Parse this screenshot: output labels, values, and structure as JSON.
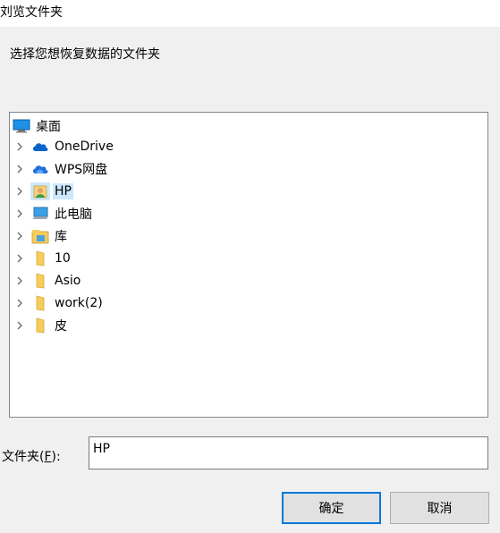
{
  "window": {
    "title": "刘览文件夹"
  },
  "instruction": "选择您想恢复数据的文件夹",
  "tree": {
    "root": {
      "label": "桌面",
      "icon": "desktop-icon"
    },
    "items": [
      {
        "label": "OneDrive",
        "icon": "onedrive-cloud-icon",
        "selected": false
      },
      {
        "label": "WPS网盘",
        "icon": "wps-cloud-icon",
        "selected": false
      },
      {
        "label": "HP",
        "icon": "user-folder-icon",
        "selected": true
      },
      {
        "label": "此电脑",
        "icon": "computer-icon",
        "selected": false
      },
      {
        "label": "库",
        "icon": "library-icon",
        "selected": false
      },
      {
        "label": "10",
        "icon": "folder-icon",
        "selected": false
      },
      {
        "label": "Asio",
        "icon": "folder-icon",
        "selected": false
      },
      {
        "label": "work(2)",
        "icon": "folder-icon",
        "selected": false
      },
      {
        "label": "皮",
        "icon": "folder-icon",
        "selected": false
      }
    ]
  },
  "folder": {
    "label_prefix": "文件夹(",
    "label_key": "F",
    "label_suffix": "):",
    "value": "HP"
  },
  "buttons": {
    "ok": "确定",
    "cancel": "取消"
  },
  "colors": {
    "selection": "#cce8ff",
    "default_button_border": "#0078d7",
    "cloud_blue": "#0a64c8",
    "folder_yellow": "#f6cd5a"
  }
}
